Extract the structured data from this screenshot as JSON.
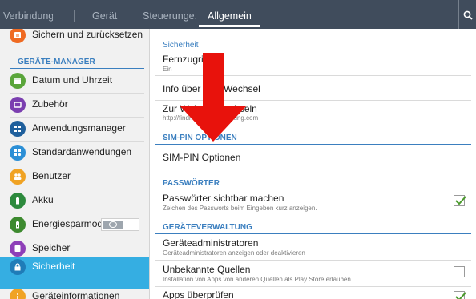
{
  "tabs": [
    {
      "label": "Verbindung.."
    },
    {
      "label": "Gerät"
    },
    {
      "label": "Steuerunge.."
    },
    {
      "label": "Allgemein"
    }
  ],
  "sidebar": {
    "top_item": {
      "label": "Sichern und zurücksetzen"
    },
    "header": "GERÄTE-MANAGER",
    "items": [
      {
        "label": "Datum und Uhrzeit"
      },
      {
        "label": "Zubehör"
      },
      {
        "label": "Anwendungsmanager"
      },
      {
        "label": "Standardanwendungen"
      },
      {
        "label": "Benutzer"
      },
      {
        "label": "Akku"
      },
      {
        "label": "Energiesparmod.."
      },
      {
        "label": "Speicher"
      },
      {
        "label": "Sicherheit"
      },
      {
        "label": "Geräteinformationen"
      }
    ],
    "energy_toggle_state": "off"
  },
  "main": {
    "title": "Sicherheit",
    "rows_top": [
      {
        "title": "Fernzugriff",
        "sub": "Ein"
      },
      {
        "title": "Info über SIM-Wechsel"
      },
      {
        "title": "Zur Website wechseln",
        "sub": "http://findmymobile.samsung.com"
      }
    ],
    "sim_section": {
      "header": "SIM-PIN OPTIONEN",
      "row": {
        "title": "SIM-PIN Optionen"
      }
    },
    "pw_section": {
      "header": "PASSWÖRTER",
      "row": {
        "title": "Passwörter sichtbar machen",
        "sub": "Zeichen des Passworts beim Eingeben kurz anzeigen.",
        "checked": true
      }
    },
    "admin_section": {
      "header": "GERÄTEVERWALTUNG",
      "rows": [
        {
          "title": "Geräteadministratoren",
          "sub": "Geräteadministratoren anzeigen oder deaktivieren"
        },
        {
          "title": "Unbekannte Quellen",
          "sub": "Installation von Apps von anderen Quellen als Play Store erlauben",
          "checked": false
        },
        {
          "title": "Apps überprüfen",
          "checked": true
        }
      ]
    }
  },
  "colors": {
    "topbar": "#404c5c",
    "accent": "#3b7fbf",
    "selected": "#35aee2",
    "arrow": "#e8120c",
    "check": "#4a9a2c"
  }
}
